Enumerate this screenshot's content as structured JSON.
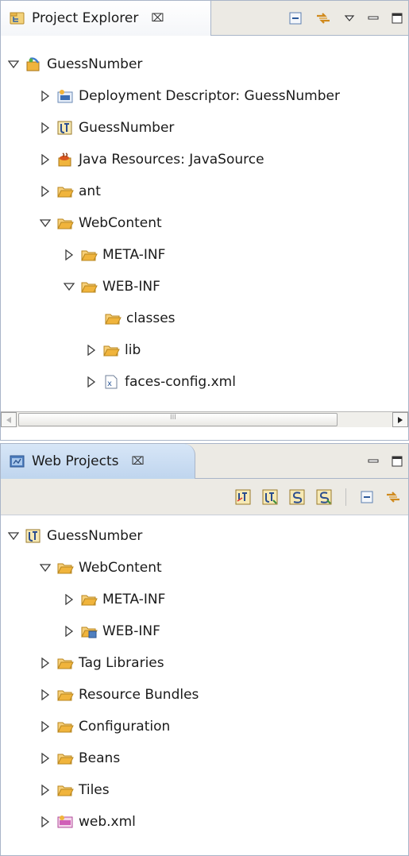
{
  "project_explorer": {
    "title": "Project Explorer",
    "close_glyph": "⌧",
    "tree": [
      {
        "label": "GuessNumber",
        "icon": "web-project-icon",
        "expanded": true
      },
      {
        "label": "Deployment Descriptor: GuessNumber",
        "icon": "deployment-descriptor-icon",
        "expanded": false
      },
      {
        "label": "GuessNumber",
        "icon": "jsf-project-icon",
        "expanded": false
      },
      {
        "label": "Java Resources: JavaSource",
        "icon": "java-resources-icon",
        "expanded": false
      },
      {
        "label": "ant",
        "icon": "folder-icon",
        "expanded": false
      },
      {
        "label": "WebContent",
        "icon": "folder-icon",
        "expanded": true
      },
      {
        "label": "META-INF",
        "icon": "folder-icon",
        "expanded": false
      },
      {
        "label": "WEB-INF",
        "icon": "folder-icon",
        "expanded": true
      },
      {
        "label": "classes",
        "icon": "folder-icon"
      },
      {
        "label": "lib",
        "icon": "folder-icon",
        "expanded": false
      },
      {
        "label": "faces-config.xml",
        "icon": "xml-file-icon",
        "expanded": false
      }
    ],
    "scrollbar_grip": "III"
  },
  "web_projects": {
    "title": "Web Projects",
    "close_glyph": "⌧",
    "tree": [
      {
        "label": "GuessNumber",
        "icon": "jsf-project-icon",
        "expanded": true
      },
      {
        "label": "WebContent",
        "icon": "folder-icon",
        "expanded": true
      },
      {
        "label": "META-INF",
        "icon": "folder-icon",
        "expanded": false
      },
      {
        "label": "WEB-INF",
        "icon": "web-inf-folder-icon",
        "expanded": false
      },
      {
        "label": "Tag Libraries",
        "icon": "folder-icon",
        "expanded": false
      },
      {
        "label": "Resource Bundles",
        "icon": "folder-icon",
        "expanded": false
      },
      {
        "label": "Configuration",
        "icon": "folder-icon",
        "expanded": false
      },
      {
        "label": "Beans",
        "icon": "folder-icon",
        "expanded": false
      },
      {
        "label": "Tiles",
        "icon": "folder-icon",
        "expanded": false
      },
      {
        "label": "web.xml",
        "icon": "web-xml-icon",
        "expanded": false
      }
    ]
  },
  "colors": {
    "folder": "#f0b43c",
    "twistie": "#3c3c3c",
    "active_tab": "#c7dbf1",
    "toolbar_bg": "#eceae4"
  }
}
